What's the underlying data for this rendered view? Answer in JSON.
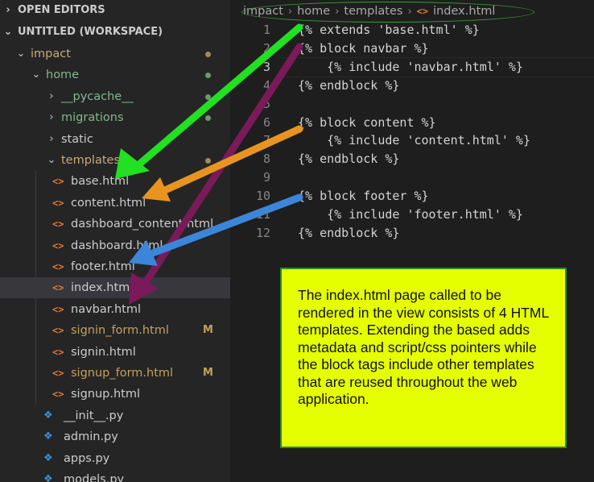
{
  "sidebar": {
    "open_editors": "OPEN EDITORS",
    "workspace": "UNTITLED (WORKSPACE)",
    "tree": [
      {
        "label": "impact",
        "kind": "folder",
        "chev": "⌄",
        "status": "modified",
        "name": "folder-impact"
      },
      {
        "label": "home",
        "kind": "folder",
        "chev": "⌄",
        "status": "clean",
        "name": "folder-home"
      },
      {
        "label": "__pycache__",
        "kind": "folder",
        "chev": "›",
        "status": "clean",
        "name": "folder-pycache"
      },
      {
        "label": "migrations",
        "kind": "folder",
        "chev": "›",
        "status": "clean",
        "name": "folder-migrations"
      },
      {
        "label": "static",
        "kind": "folder",
        "chev": "›",
        "status": "",
        "name": "folder-static"
      },
      {
        "label": "templates",
        "kind": "folder",
        "chev": "⌄",
        "status": "modified",
        "name": "folder-templates"
      },
      {
        "label": "base.html",
        "kind": "html",
        "name": "file-base-html"
      },
      {
        "label": "content.html",
        "kind": "html",
        "name": "file-content-html"
      },
      {
        "label": "dashboard_content.html",
        "kind": "html",
        "name": "file-dashboard-content-html"
      },
      {
        "label": "dashboard.html",
        "kind": "html",
        "name": "file-dashboard-html"
      },
      {
        "label": "footer.html",
        "kind": "html",
        "name": "file-footer-html"
      },
      {
        "label": "index.html",
        "kind": "html",
        "selected": true,
        "name": "file-index-html"
      },
      {
        "label": "navbar.html",
        "kind": "html",
        "name": "file-navbar-html"
      },
      {
        "label": "signin_form.html",
        "kind": "html",
        "badge": "M",
        "name": "file-signin-form-html"
      },
      {
        "label": "signin.html",
        "kind": "html",
        "name": "file-signin-html"
      },
      {
        "label": "signup_form.html",
        "kind": "html",
        "badge": "M",
        "name": "file-signup-form-html"
      },
      {
        "label": "signup.html",
        "kind": "html",
        "name": "file-signup-html"
      },
      {
        "label": "__init__.py",
        "kind": "py",
        "name": "file-init-py"
      },
      {
        "label": "admin.py",
        "kind": "py",
        "name": "file-admin-py"
      },
      {
        "label": "apps.py",
        "kind": "py",
        "name": "file-apps-py"
      },
      {
        "label": "models.py",
        "kind": "py",
        "name": "file-models-py"
      }
    ]
  },
  "breadcrumb": [
    "impact",
    "home",
    "templates",
    "index.html"
  ],
  "editor": {
    "lines": [
      {
        "n": "1",
        "code": "{% extends 'base.html' %}"
      },
      {
        "n": "2",
        "code": "{% block navbar %}"
      },
      {
        "n": "3",
        "code": "    {% include 'navbar.html' %}"
      },
      {
        "n": "4",
        "code": "{% endblock %}"
      },
      {
        "n": "5",
        "code": ""
      },
      {
        "n": "6",
        "code": "{% block content %}"
      },
      {
        "n": "7",
        "code": "    {% include 'content.html' %}"
      },
      {
        "n": "8",
        "code": "{% endblock %}"
      },
      {
        "n": "9",
        "code": ""
      },
      {
        "n": "10",
        "code": "{% block footer %}"
      },
      {
        "n": "11",
        "code": "    {% include 'footer.html' %}"
      },
      {
        "n": "12",
        "code": "{% endblock %}"
      }
    ],
    "active_line": "3"
  },
  "annotation": {
    "text": "The index.html page called to be rendered in the view consists of 4 HTML templates.  Extending the based adds metadata and script/css pointers while the block tags include other templates that are reused throughout the web application."
  },
  "colors": {
    "arrow_green": "#22e022",
    "arrow_orange": "#e8951f",
    "arrow_blue": "#3b86d9",
    "arrow_purple": "#7a1a5a",
    "note_bg": "#e6ff00",
    "modified_dot": "#a08a5a",
    "clean_dot": "#6b9a6b"
  },
  "icons": {
    "html": "html-brackets-icon",
    "py": "python-icon",
    "folder_open": "chevron-down-icon",
    "folder_closed": "chevron-right-icon"
  }
}
